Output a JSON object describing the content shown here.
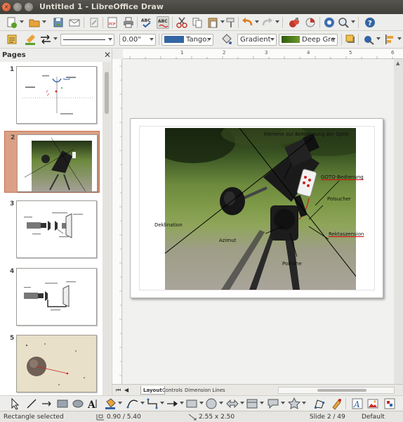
{
  "window": {
    "title": "Untitled 1 - LibreOffice Draw"
  },
  "toolbar": {
    "line_width_value": "",
    "position_value": "0.00\"",
    "line_color": {
      "name": "Tango:",
      "hex": "#3465a4"
    },
    "area_style_value": "Gradient",
    "gradient": {
      "name": "Deep Gre",
      "hex": "#4e7a1f"
    }
  },
  "pages_panel": {
    "title": "Pages",
    "slides": [
      {
        "number": "1"
      },
      {
        "number": "2"
      },
      {
        "number": "3"
      },
      {
        "number": "4"
      },
      {
        "number": "5"
      }
    ]
  },
  "ruler": {
    "numbers": [
      "1",
      "2",
      "3",
      "4",
      "5",
      "6"
    ]
  },
  "slide_labels": {
    "klemme": "Klemme zur Befestigung der Optik",
    "goto": "GOTO-Bedienung",
    "polsucher": "Polsucher",
    "deklination": "Deklination",
    "rektaszension": "Rektaszension",
    "azimut": "Azimut",
    "polhoehe": "Polhöhe"
  },
  "tabs": [
    "Layout",
    "Controls",
    "Dimension Lines"
  ],
  "status": {
    "selection": "Rectangle selected",
    "position": "0.90 / 5.40",
    "size": "2.55 x 2.50",
    "slide": "Slide 2 / 49",
    "layout": "Default"
  },
  "colors": {
    "selected_slide_bg": "#dba085",
    "close_button": "#e05423"
  }
}
